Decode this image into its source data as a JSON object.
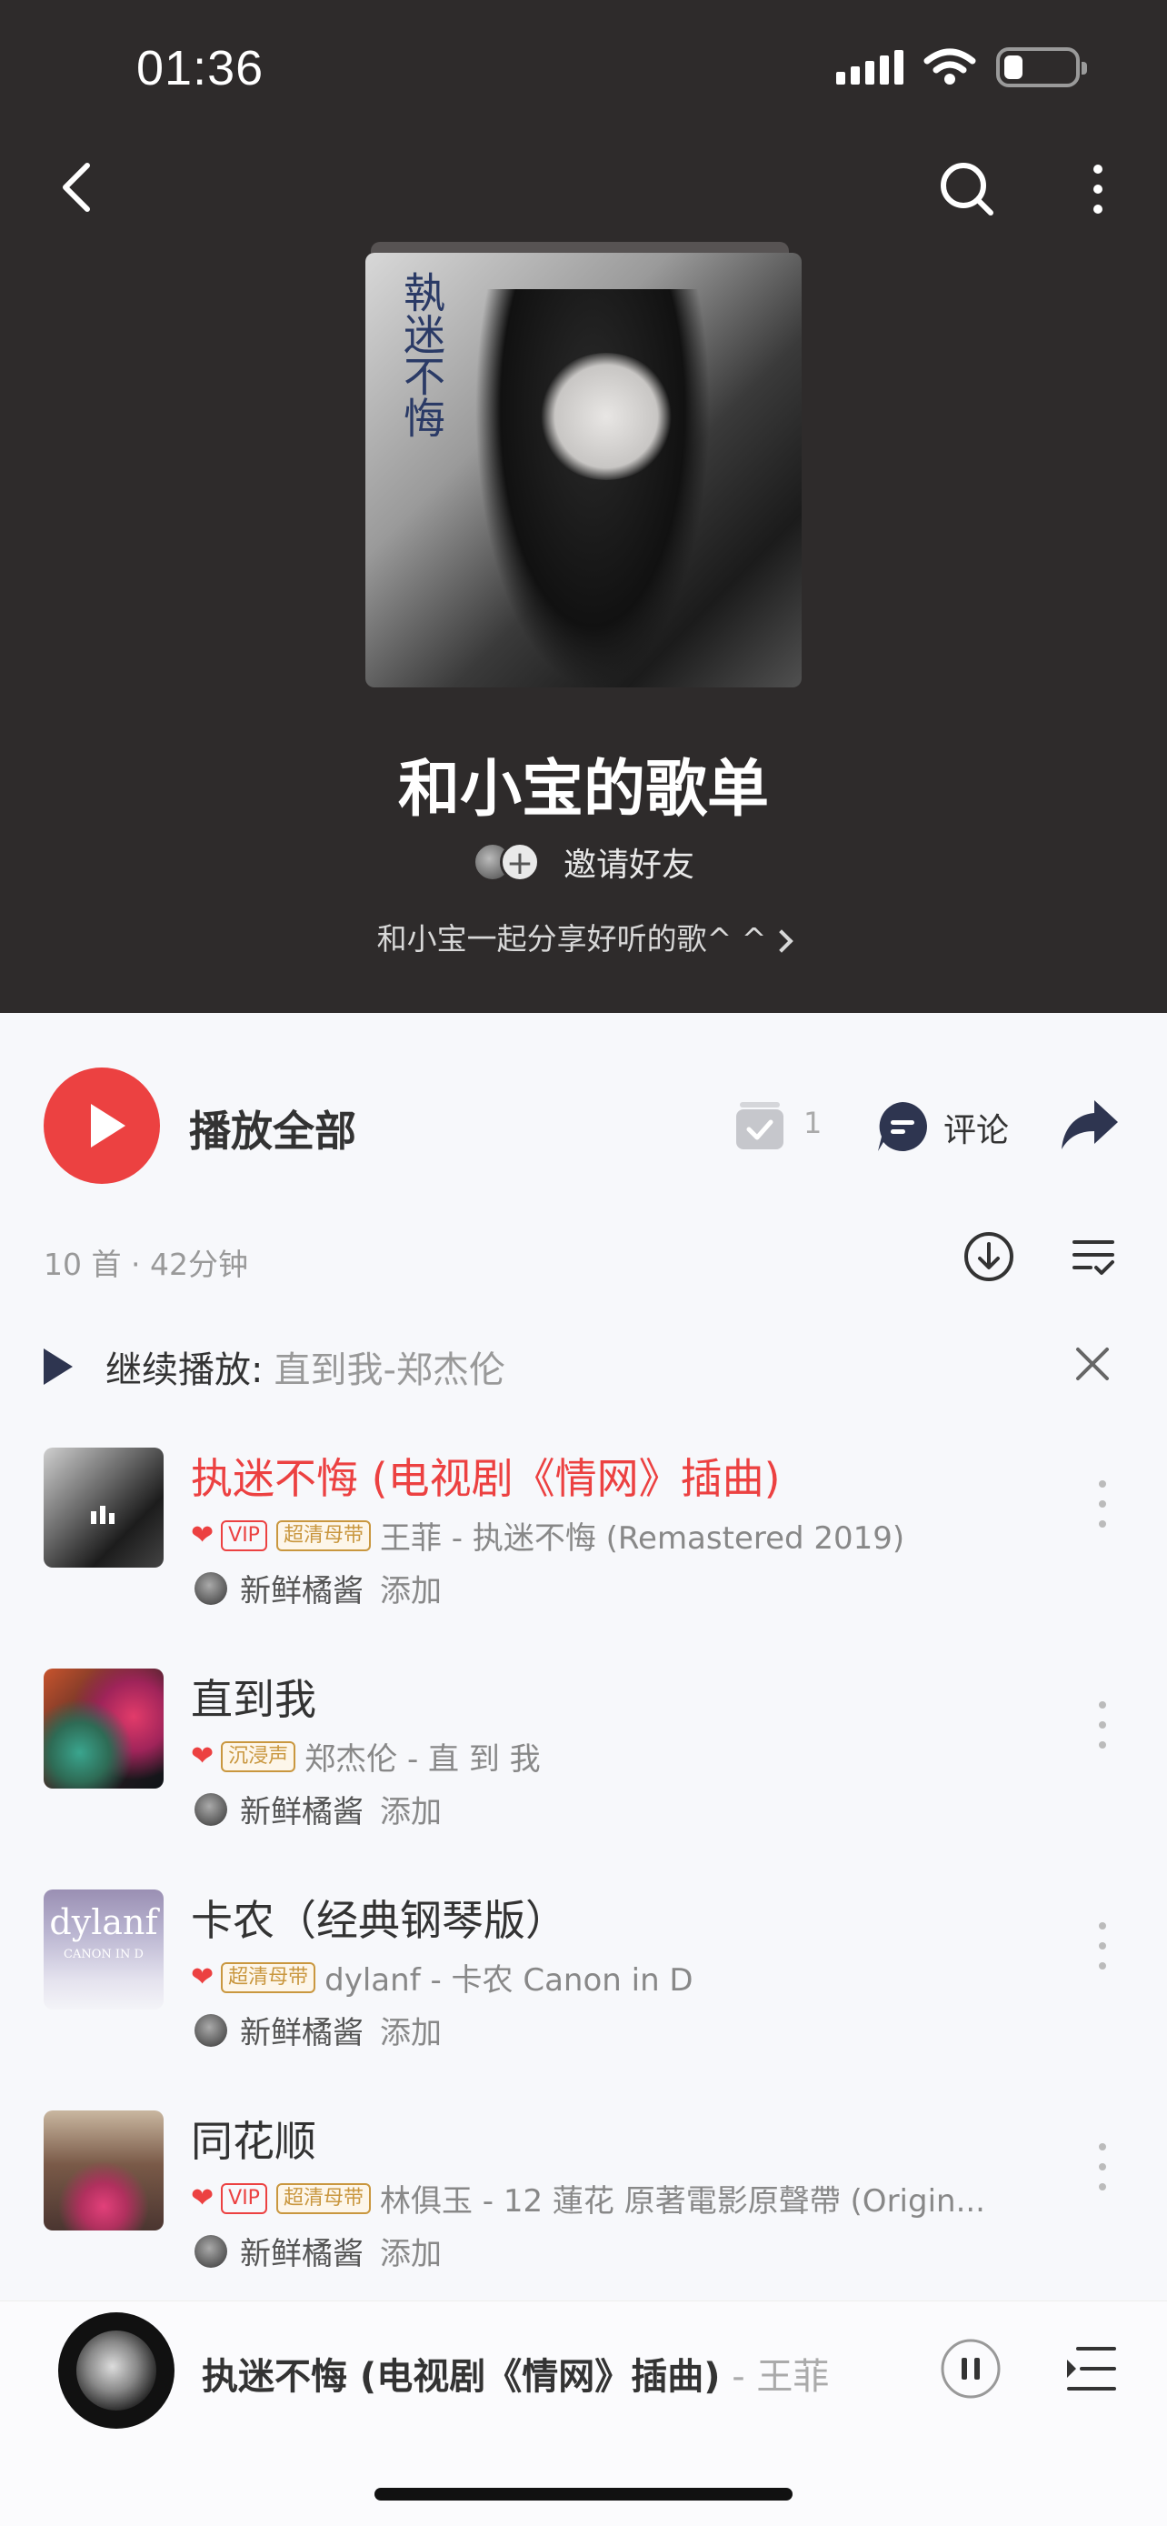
{
  "status_bar": {
    "time": "01:36"
  },
  "playlist": {
    "title": "和小宝的歌单",
    "invite_label": "邀请好友",
    "description": "和小宝一起分享好听的歌^ ^",
    "cover_text": "執迷不悔"
  },
  "actions": {
    "play_all_label": "播放全部",
    "collect_count": "1",
    "comment_label": "评论"
  },
  "meta": "10 首 · 42分钟",
  "continue": {
    "label": "继续播放:",
    "song": "直到我-郑杰伦"
  },
  "songs": [
    {
      "title": "执迷不悔 (电视剧《情网》插曲)",
      "playing": true,
      "tags": [
        "VIP",
        "超清母带"
      ],
      "artist_album": "王菲 - 执迷不悔 (Remastered 2019)",
      "adder": "新鲜橘酱",
      "adder_action": "添加"
    },
    {
      "title": "直到我",
      "playing": false,
      "tags": [
        "沉浸声"
      ],
      "artist_album": "郑杰伦 - 直 到 我",
      "adder": "新鲜橘酱",
      "adder_action": "添加"
    },
    {
      "title": "卡农（经典钢琴版）",
      "playing": false,
      "tags": [
        "超清母带"
      ],
      "artist_album": "dylanf - 卡农 Canon in D",
      "adder": "新鲜橘酱",
      "adder_action": "添加",
      "thumb_text": "dylanf",
      "thumb_sub": "CANON IN D"
    },
    {
      "title": "同花顺",
      "playing": false,
      "tags": [
        "VIP",
        "超清母带"
      ],
      "artist_album": "林俱玉 - 12 蓮花 原著電影原聲帶 (Origin...",
      "adder": "新鲜橘酱",
      "adder_action": "添加"
    }
  ],
  "mini_player": {
    "title": "执迷不悔 (电视剧《情网》插曲)",
    "artist": " - 王菲"
  },
  "colors": {
    "accent": "#ec4141",
    "header_bg": "#2e2b2b",
    "gold_tag": "#c9973f"
  }
}
